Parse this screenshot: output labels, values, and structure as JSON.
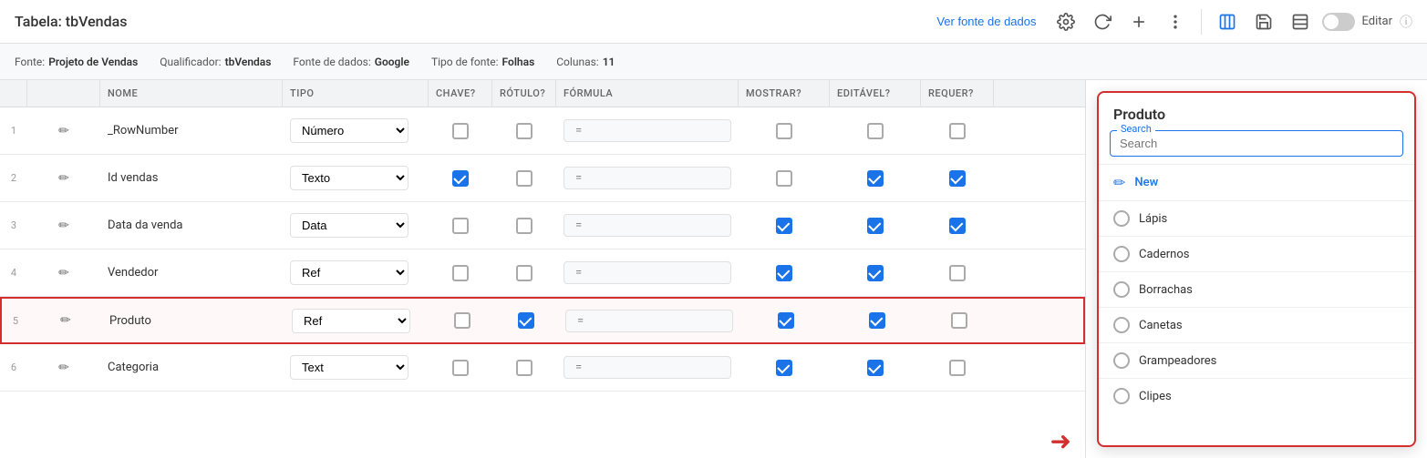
{
  "header": {
    "title": "Tabela: tbVendas",
    "ver_fonte_label": "Ver fonte de dados",
    "editar_label": "Editar"
  },
  "meta": {
    "fonte_label": "Fonte:",
    "fonte_value": "Projeto de Vendas",
    "qualificador_label": "Qualificador:",
    "qualificador_value": "tbVendas",
    "fonte_dados_label": "Fonte de dados:",
    "fonte_dados_value": "Google",
    "tipo_fonte_label": "Tipo de fonte:",
    "tipo_fonte_value": "Folhas",
    "colunas_label": "Colunas:",
    "colunas_value": "11"
  },
  "columns": {
    "nome": "NOME",
    "tipo": "TIPO",
    "chave": "CHAVE?",
    "rotulo": "RÓTULO?",
    "formula": "FÓRMULA",
    "mostrar": "MOSTRAR?",
    "editavel": "EDITÁVEL?",
    "requer": "REQUER?"
  },
  "rows": [
    {
      "num": "1",
      "name": "_RowNumber",
      "type": "Número",
      "chave": false,
      "rotulo": false,
      "formula": "=",
      "mostrar": false,
      "editavel": false,
      "requer": false,
      "highlighted": false
    },
    {
      "num": "2",
      "name": "Id vendas",
      "type": "Texto",
      "chave": true,
      "rotulo": false,
      "formula": "=",
      "mostrar": false,
      "editavel": true,
      "requer": true,
      "highlighted": false
    },
    {
      "num": "3",
      "name": "Data da venda",
      "type": "Data",
      "chave": false,
      "rotulo": false,
      "formula": "=",
      "mostrar": true,
      "editavel": true,
      "requer": true,
      "highlighted": false
    },
    {
      "num": "4",
      "name": "Vendedor",
      "type": "Ref",
      "chave": false,
      "rotulo": false,
      "formula": "=",
      "mostrar": true,
      "editavel": true,
      "requer": false,
      "highlighted": false
    },
    {
      "num": "5",
      "name": "Produto",
      "type": "Ref",
      "chave": false,
      "rotulo": true,
      "formula": "=",
      "mostrar": true,
      "editavel": true,
      "requer": false,
      "highlighted": true
    },
    {
      "num": "6",
      "name": "Categoria",
      "type": "Text",
      "chave": false,
      "rotulo": false,
      "formula": "=",
      "mostrar": true,
      "editavel": true,
      "requer": false,
      "highlighted": false
    }
  ],
  "dropdown": {
    "title": "Produto",
    "search_placeholder": "Search",
    "search_label": "Search",
    "items": [
      {
        "label": "New",
        "is_new": true,
        "selected": false
      },
      {
        "label": "Lápis",
        "is_new": false,
        "selected": false
      },
      {
        "label": "Cadernos",
        "is_new": false,
        "selected": false
      },
      {
        "label": "Borrachas",
        "is_new": false,
        "selected": false
      },
      {
        "label": "Canetas",
        "is_new": false,
        "selected": false
      },
      {
        "label": "Grampeadores",
        "is_new": false,
        "selected": false
      },
      {
        "label": "Clipes",
        "is_new": false,
        "selected": false
      }
    ]
  }
}
